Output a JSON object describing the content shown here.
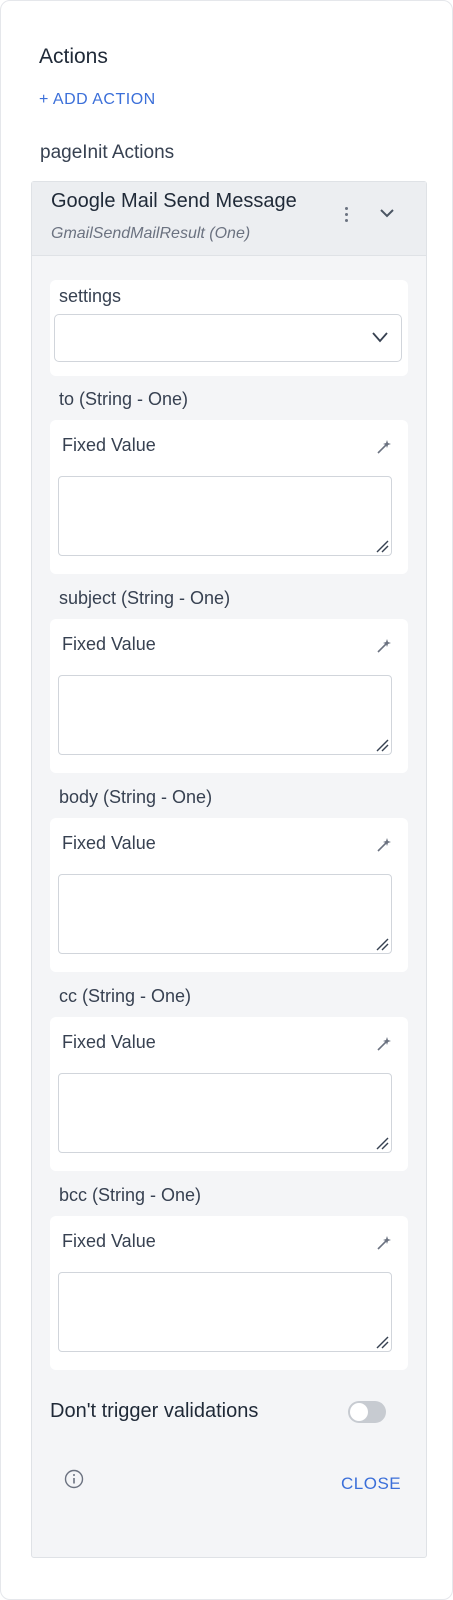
{
  "header": {
    "title": "Actions",
    "add_action": "+ ADD ACTION",
    "section": "pageInit Actions"
  },
  "action": {
    "title": "Google Mail Send Message",
    "subtitle": "GmailSendMailResult (One)",
    "settings": {
      "label": "settings",
      "value": ""
    },
    "fields": [
      {
        "label": "to (String - One)",
        "mode": "Fixed Value",
        "value": ""
      },
      {
        "label": "subject (String - One)",
        "mode": "Fixed Value",
        "value": ""
      },
      {
        "label": "body (String - One)",
        "mode": "Fixed Value",
        "value": ""
      },
      {
        "label": "cc (String - One)",
        "mode": "Fixed Value",
        "value": ""
      },
      {
        "label": "bcc (String - One)",
        "mode": "Fixed Value",
        "value": ""
      }
    ],
    "toggle_label": "Don't trigger validations",
    "toggle_on": false,
    "close_label": "CLOSE"
  },
  "icons": [
    "kebab-icon",
    "chevron-down-icon",
    "magic-wand-icon",
    "info-icon"
  ],
  "colors": {
    "accent": "#3b6fd9",
    "card_bg": "#f4f5f7",
    "toggle_off": "#c7cbd1"
  }
}
